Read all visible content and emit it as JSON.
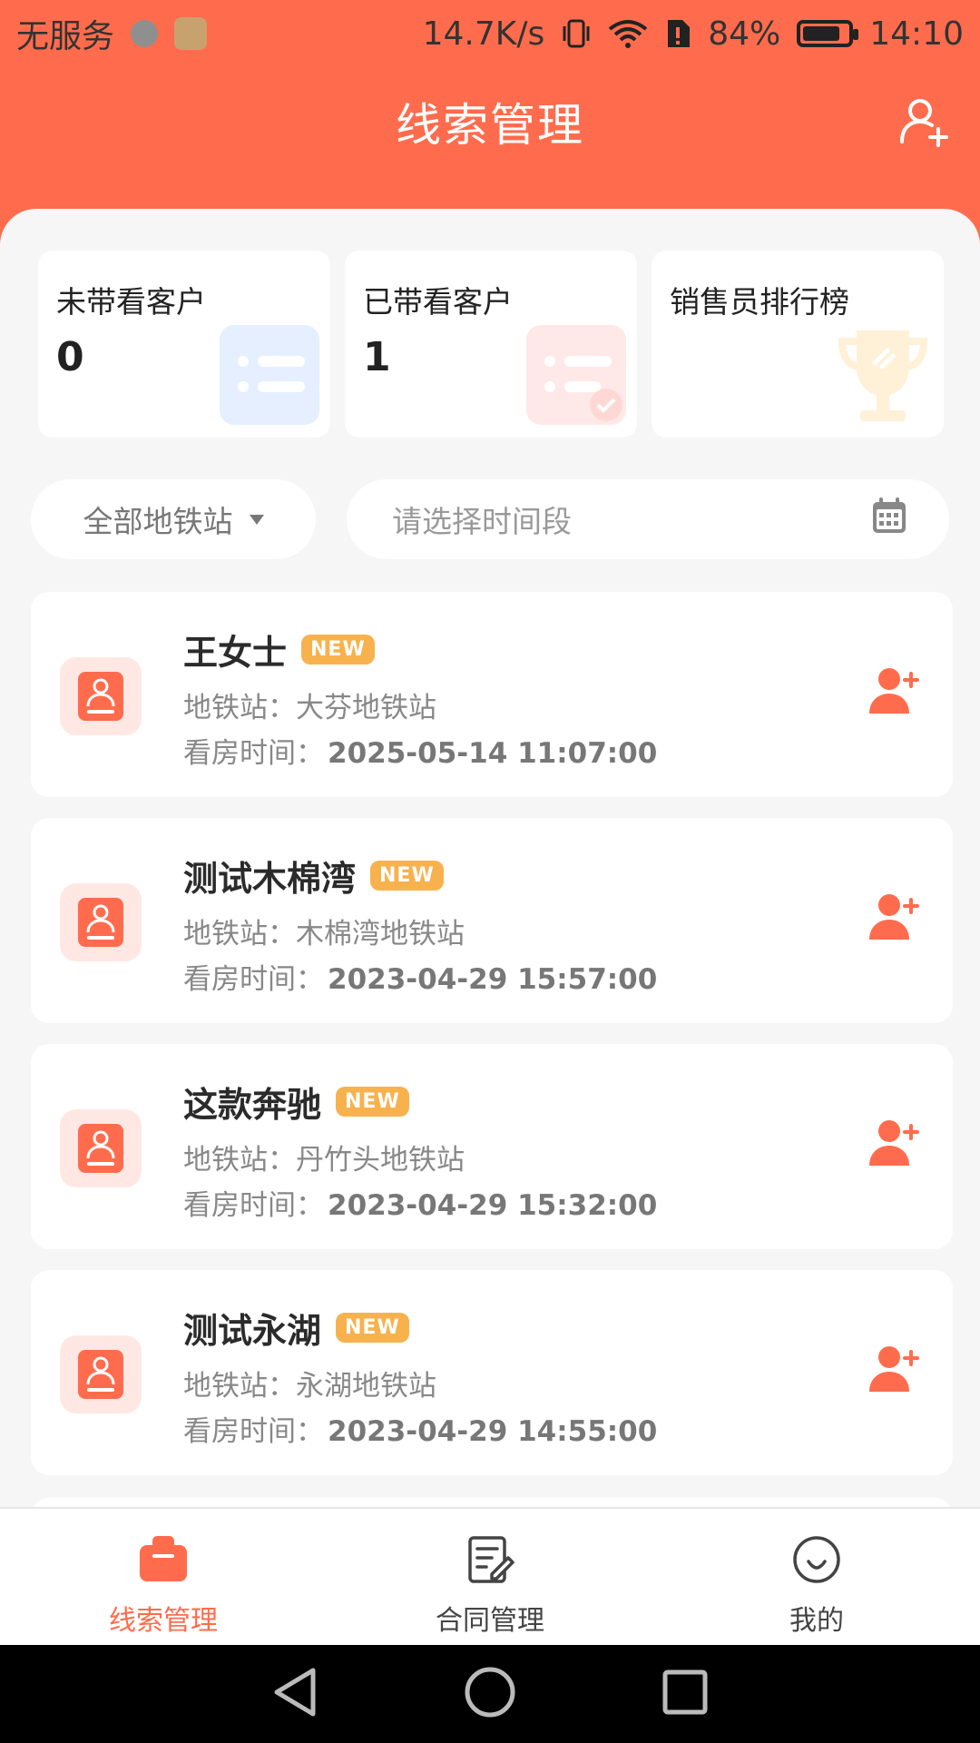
{
  "statusbar": {
    "carrier": "无服务",
    "network_speed": "14.7K/s",
    "battery_percent": "84%",
    "battery_level": 0.84,
    "time": "14:10"
  },
  "header": {
    "title": "线索管理"
  },
  "summary": {
    "cards": [
      {
        "label": "未带看客户",
        "value": "0"
      },
      {
        "label": "已带看客户",
        "value": "1"
      },
      {
        "label": "销售员排行榜",
        "value": ""
      }
    ]
  },
  "filters": {
    "station": "全部地铁站",
    "date_placeholder": "请选择时间段"
  },
  "leads": [
    {
      "name": "王女士",
      "badge": "NEW",
      "station": "地铁站：大芬地铁站",
      "time_label": "看房时间：",
      "time": "2025-05-14 11:07:00"
    },
    {
      "name": "测试木棉湾",
      "badge": "NEW",
      "station": "地铁站：木棉湾地铁站",
      "time_label": "看房时间：",
      "time": "2023-04-29 15:57:00"
    },
    {
      "name": "这款奔驰",
      "badge": "NEW",
      "station": "地铁站：丹竹头地铁站",
      "time_label": "看房时间：",
      "time": "2023-04-29 15:32:00"
    },
    {
      "name": "测试永湖",
      "badge": "NEW",
      "station": "地铁站：永湖地铁站",
      "time_label": "看房时间：",
      "time": "2023-04-29 14:55:00"
    }
  ],
  "bottom_nav": {
    "items": [
      {
        "label": "线索管理",
        "icon": "clue-icon",
        "active": true
      },
      {
        "label": "合同管理",
        "icon": "contract-icon",
        "active": false
      },
      {
        "label": "我的",
        "icon": "smile-icon",
        "active": false
      }
    ]
  },
  "colors": {
    "primary": "#ff6c4d",
    "badge": "#f7b24e"
  }
}
